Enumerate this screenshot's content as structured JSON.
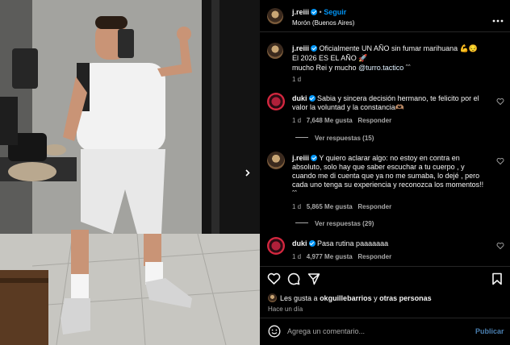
{
  "header": {
    "username": "j.reiii",
    "follow_label": "Seguir",
    "location": "Morón (Buenos Aires)",
    "more_icon": "more-dots-icon"
  },
  "caption": {
    "username": "j.reiii",
    "line1": "Oficialmente UN AÑO sin fumar marihuana",
    "line1_emoji": "💪😔",
    "line2": "El 2026 ES EL AÑO",
    "line2_emoji": "🚀",
    "line3_prefix": "mucho Rei y mucho",
    "mention": "@turro.tactico",
    "line3_suffix": "ˆˆ",
    "time": "1 d"
  },
  "comments": [
    {
      "username": "duki",
      "text_lines": [
        "Sabia y sincera decisión hermano, te felicito por el",
        "valor la voluntad y la constancia🫶🏽"
      ],
      "time": "1 d",
      "likes": "7,648 Me gusta",
      "reply_label": "Responder",
      "view_replies": "Ver respuestas (15)"
    },
    {
      "username": "j.reiii",
      "text_lines": [
        "Y quiero aclarar algo: no estoy en contra en",
        "absoluto, solo hay que saber escuchar a tu cuerpo , y",
        "cuando me di cuenta que ya no me sumaba, lo dejé , pero",
        "cada uno tenga su experiencia y reconozca los momentos!!",
        "ˆˆ"
      ],
      "time": "1 d",
      "likes": "5,865 Me gusta",
      "reply_label": "Responder",
      "view_replies": "Ver respuestas (29)"
    },
    {
      "username": "duki",
      "text_lines": [
        "Pasa rutina paaaaaaa"
      ],
      "time": "1 d",
      "likes": "4,977 Me gusta",
      "reply_label": "Responder",
      "view_replies": ""
    }
  ],
  "actions": {
    "icons": [
      "heart-icon",
      "comment-icon",
      "share-icon",
      "bookmark-icon"
    ],
    "liked_by_prefix": "Les gusta a",
    "liked_by_user": "okguillebarrios",
    "liked_by_connector": "y",
    "liked_by_others": "otras personas",
    "posted_ago": "Hace un día"
  },
  "composer": {
    "placeholder": "Agrega un comentario...",
    "publish_label": "Publicar",
    "emoji_icon": "emoji-icon"
  },
  "colors": {
    "accent": "#0095f6",
    "background": "#000000",
    "muted_text": "#a8a8a8"
  }
}
